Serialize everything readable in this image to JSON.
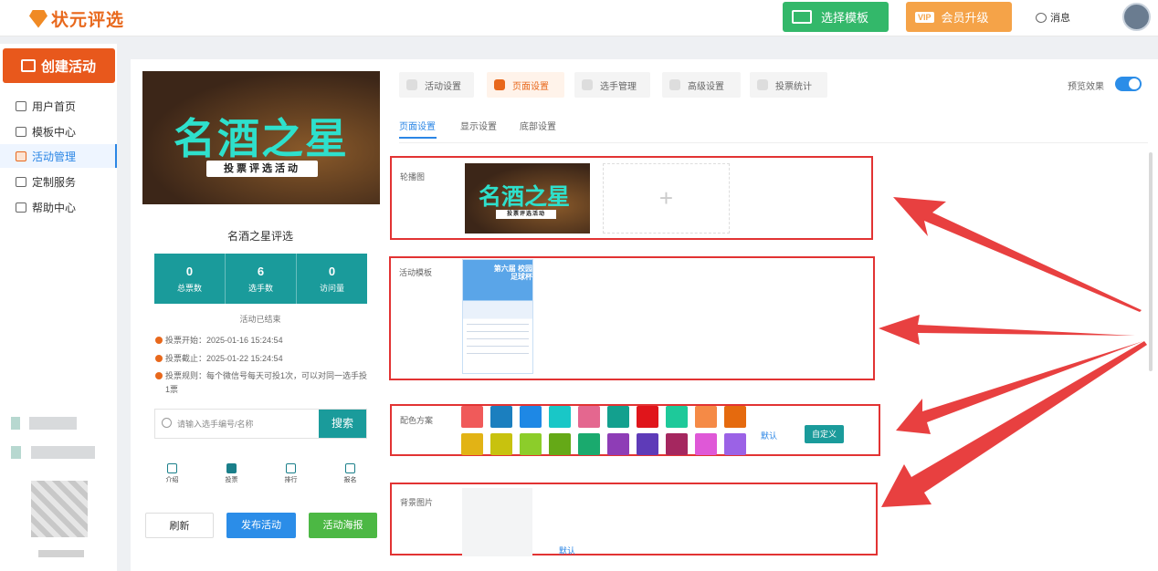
{
  "header": {
    "logo": "状元评选",
    "choose_template": "选择模板",
    "vip_badge": "VIP",
    "vip_upgrade": "会员升级",
    "messages": "消息"
  },
  "sidebar": {
    "create": "创建活动",
    "items": [
      {
        "label": "用户首页",
        "icon": "home-icon"
      },
      {
        "label": "模板中心",
        "icon": "template-icon"
      },
      {
        "label": "活动管理",
        "icon": "ticket-icon"
      },
      {
        "label": "定制服务",
        "icon": "link-icon"
      },
      {
        "label": "帮助中心",
        "icon": "help-icon"
      }
    ]
  },
  "preview": {
    "banner_title": "名酒之星",
    "banner_sub": "投票评选活动",
    "title": "名酒之星评选",
    "stats": [
      {
        "value": "0",
        "label": "总票数"
      },
      {
        "value": "6",
        "label": "选手数"
      },
      {
        "value": "0",
        "label": "访问量"
      }
    ],
    "status": "活动已结束",
    "vote_start": "投票开始：2025-01-16 15:24:54",
    "vote_end": "投票截止：2025-01-22 15:24:54",
    "vote_rule": "投票规则：每个微信号每天可投1次，可以对同一选手投1票",
    "search_placeholder": "请输入选手编号/名称",
    "search_button": "搜索",
    "tabs": [
      "介绍",
      "投票",
      "排行",
      "报名"
    ],
    "refresh": "刷新",
    "publish": "发布活动",
    "poster": "活动海报"
  },
  "config": {
    "tabs": [
      "活动设置",
      "页面设置",
      "选手管理",
      "高级设置",
      "投票统计"
    ],
    "preview_label": "预览效果",
    "subtabs": [
      "页面设置",
      "显示设置",
      "底部设置"
    ],
    "carousel_label": "轮播图",
    "add_symbol": "+",
    "template_label": "活动模板",
    "template_thumb_text": "第六届 校园足球杯",
    "color_label": "配色方案",
    "colors": [
      "#f05a5a",
      "#1b7fbf",
      "#1e88e5",
      "#19c7c7",
      "#e4678f",
      "#13a08e",
      "#e0151b",
      "#1ec99a",
      "#f58a46",
      "#e56a0e",
      "#e2b315",
      "#c8c20e",
      "#8ccd2a",
      "#65a917",
      "#1aaa6e",
      "#8e3db6",
      "#5e3bb8",
      "#a5275f",
      "#df58d7",
      "#9b62e6"
    ],
    "default_color": "默认",
    "custom_color": "自定义",
    "background_label": "背景图片",
    "default_bg": "默认"
  }
}
